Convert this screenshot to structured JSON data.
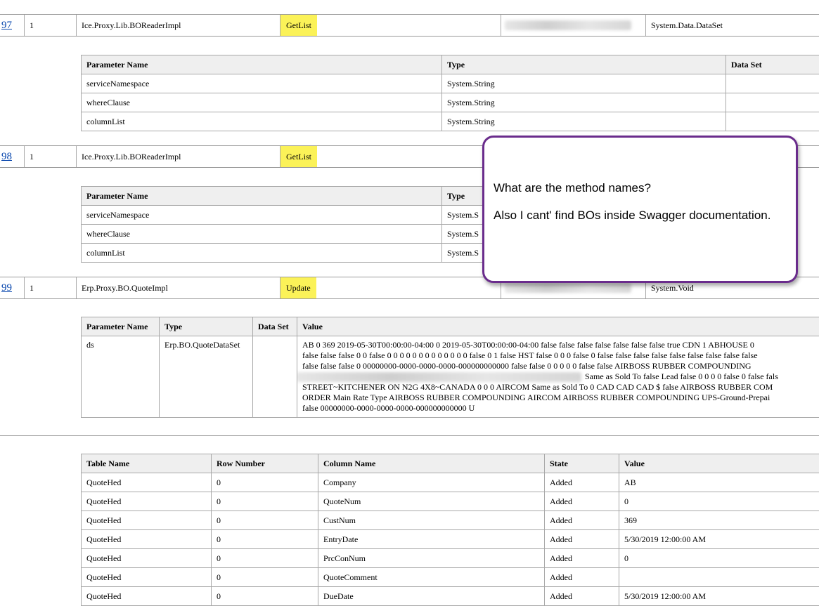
{
  "method_rows": [
    {
      "id": "97",
      "count": "1",
      "class_name": "Ice.Proxy.Lib.BOReaderImpl",
      "method": "GetList",
      "return_type": "System.Data.DataSet"
    },
    {
      "id": "98",
      "count": "1",
      "class_name": "Ice.Proxy.Lib.BOReaderImpl",
      "method": "GetList",
      "return_type": ""
    },
    {
      "id": "99",
      "count": "1",
      "class_name": "Erp.Proxy.BO.QuoteImpl",
      "method": "Update",
      "return_type": "System.Void"
    }
  ],
  "param_table_97": {
    "headers": [
      "Parameter Name",
      "Type",
      "Data Set"
    ],
    "rows": [
      [
        "serviceNamespace",
        "System.String",
        ""
      ],
      [
        "whereClause",
        "System.String",
        ""
      ],
      [
        "columnList",
        "System.String",
        ""
      ]
    ]
  },
  "param_table_98": {
    "headers": [
      "Parameter Name",
      "Type"
    ],
    "rows": [
      [
        "serviceNamespace",
        "System.S"
      ],
      [
        "whereClause",
        "System.S"
      ],
      [
        "columnList",
        "System.S"
      ]
    ]
  },
  "param_table_99": {
    "headers": [
      "Parameter Name",
      "Type",
      "Data Set",
      "Value"
    ],
    "row": {
      "name": "ds",
      "type": "Erp.BO.QuoteDataSet",
      "dataset": ""
    },
    "value_lines": [
      "AB 0 369 2019-05-30T00:00:00-04:00 0 2019-05-30T00:00:00-04:00 false false false false false false false true CDN 1 ABHOUSE 0",
      "false false false 0 0 false 0 0 0 0 0 0 0 0 0 0 0 0 0 false 0 1 false HST false 0 0 0 false 0 false false false false false false false false false",
      "false false false 0 00000000-0000-0000-0000-000000000000 false false 0 0 0 0 0 false false AIRBOSS RUBBER COMPOUNDING",
      "Same as Sold To false Lead false 0 0 0 0 false 0 false fals",
      "STREET~KITCHENER ON N2G 4X8~CANADA 0 0 0 AIRCOM Same as Sold To 0 CAD CAD CAD $ false AIRBOSS RUBBER COM",
      "ORDER Main Rate Type AIRBOSS RUBBER COMPOUNDING AIRCOM AIRBOSS RUBBER COMPOUNDING UPS-Ground-Prepai",
      "false 00000000-0000-0000-0000-000000000000 U"
    ]
  },
  "changes_table": {
    "headers": [
      "Table Name",
      "Row Number",
      "Column Name",
      "State",
      "Value"
    ],
    "rows": [
      [
        "QuoteHed",
        "0",
        "Company",
        "Added",
        "AB"
      ],
      [
        "QuoteHed",
        "0",
        "QuoteNum",
        "Added",
        "0"
      ],
      [
        "QuoteHed",
        "0",
        "CustNum",
        "Added",
        "369"
      ],
      [
        "QuoteHed",
        "0",
        "EntryDate",
        "Added",
        "5/30/2019 12:00:00 AM"
      ],
      [
        "QuoteHed",
        "0",
        "PrcConNum",
        "Added",
        "0"
      ],
      [
        "QuoteHed",
        "0",
        "QuoteComment",
        "Added",
        ""
      ],
      [
        "QuoteHed",
        "0",
        "DueDate",
        "Added",
        "5/30/2019 12:00:00 AM"
      ]
    ]
  },
  "callout": {
    "question": "What are the method names?",
    "note": "Also I cant' find BOs inside Swagger documentation."
  },
  "colors": {
    "highlight": "#fbf258",
    "callout_border": "#6a2c8c",
    "link": "#0645ad"
  }
}
